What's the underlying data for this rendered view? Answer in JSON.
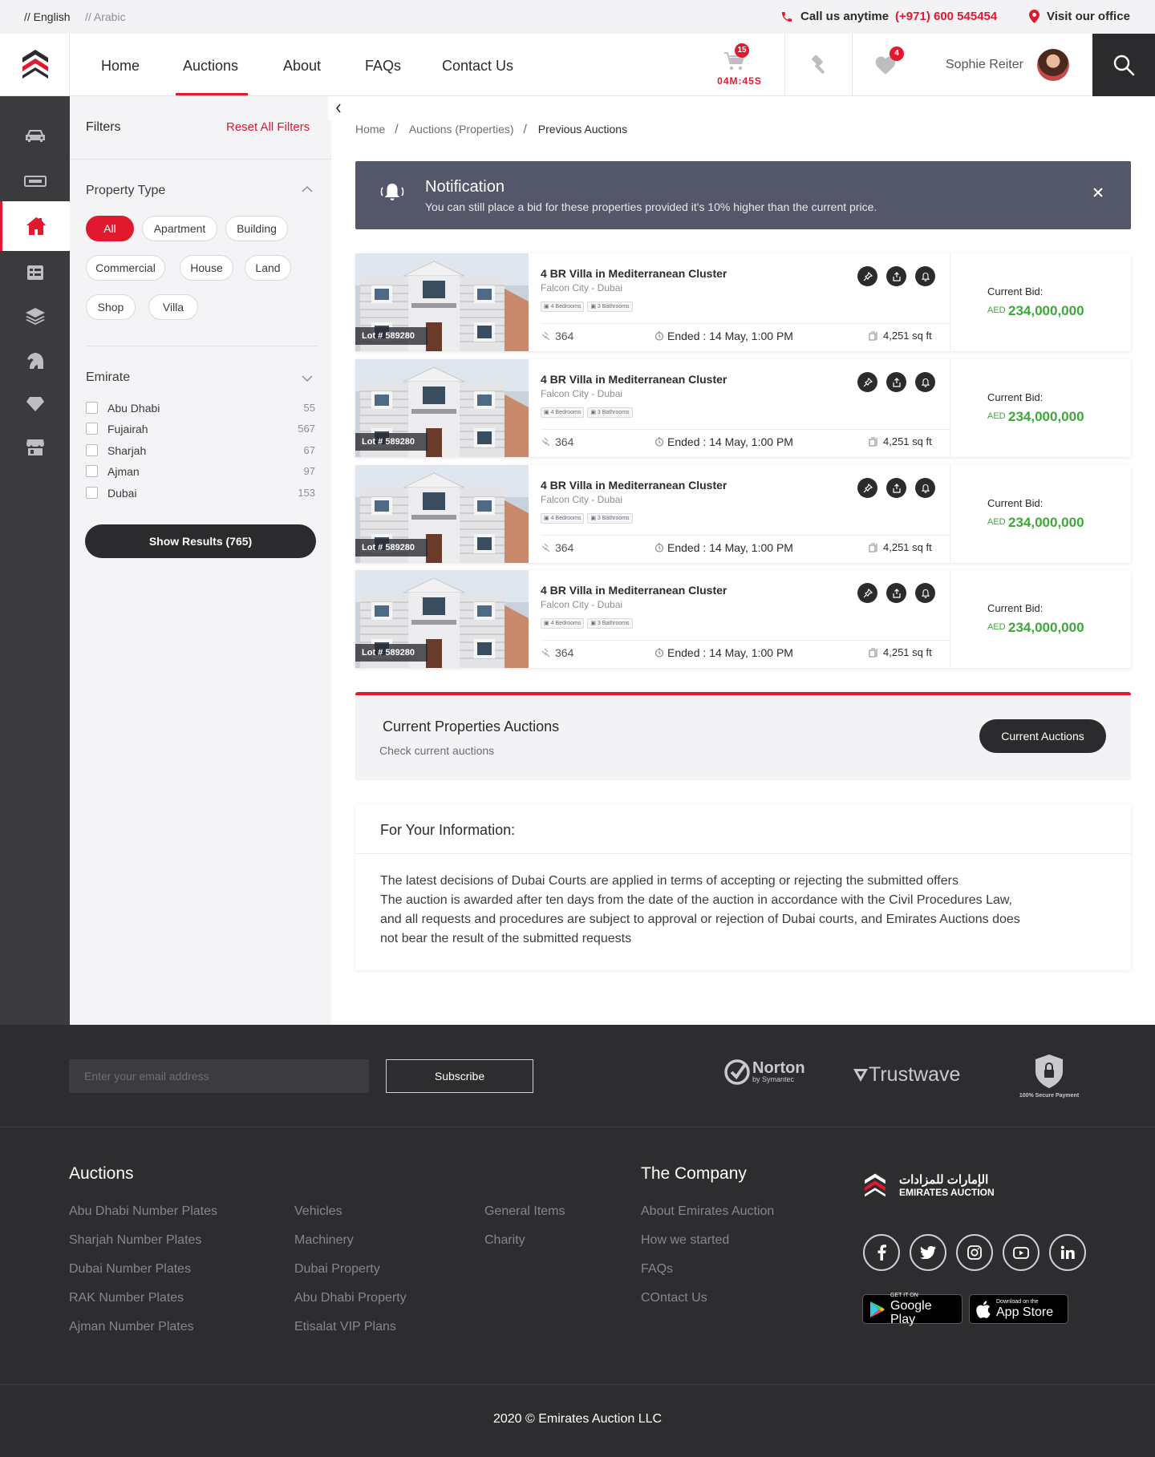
{
  "topbar": {
    "lang_en": "// English",
    "lang_ar": "// Arabic",
    "call_label": "Call us anytime",
    "phone": "(+971) 600 545454",
    "office": "Visit our office"
  },
  "nav": {
    "items": [
      "Home",
      "Auctions",
      "About",
      "FAQs",
      "Contact Us"
    ],
    "active": "Auctions"
  },
  "header": {
    "cart_count": "15",
    "timer": "04M:45S",
    "wishlist_count": "4",
    "user_name": "Sophie Reiter"
  },
  "filters": {
    "title": "Filters",
    "reset": "Reset All Filters",
    "property_type_title": "Property Type",
    "chips": [
      "All",
      "Apartment",
      "Building",
      "Commercial",
      "House",
      "Land",
      "Shop",
      "Villa"
    ],
    "selected_chip": "All",
    "emirate_title": "Emirate",
    "emirates": [
      {
        "name": "Abu Dhabi",
        "count": "55"
      },
      {
        "name": "Fujairah",
        "count": "567"
      },
      {
        "name": "Sharjah",
        "count": "67"
      },
      {
        "name": "Ajman",
        "count": "97"
      },
      {
        "name": "Dubai",
        "count": "153"
      }
    ],
    "show_results": "Show Results (765)"
  },
  "breadcrumb": {
    "items": [
      "Home",
      "Auctions (Properties)",
      "Previous Auctions"
    ],
    "separator": "/"
  },
  "notification": {
    "title": "Notification",
    "message": "You can still place a bid for these properties provided it's 10% higher than the current price."
  },
  "listings": [
    {
      "lot": "Lot # 589280",
      "title": "4 BR Villa in Mediterranean Cluster",
      "location": "Falcon City - Dubai",
      "bedrooms": "4 Bedrooms",
      "bathrooms": "3 Bathrooms",
      "bids": "364",
      "ended": "Ended : 14 May, 1:00 PM",
      "area": "4,251 sq ft",
      "bid_label": "Current Bid:",
      "currency": "AED",
      "amount": "234,000,000"
    },
    {
      "lot": "Lot # 589280",
      "title": "4 BR Villa in Mediterranean Cluster",
      "location": "Falcon City - Dubai",
      "bedrooms": "4 Bedrooms",
      "bathrooms": "3 Bathrooms",
      "bids": "364",
      "ended": "Ended : 14 May, 1:00 PM",
      "area": "4,251 sq ft",
      "bid_label": "Current Bid:",
      "currency": "AED",
      "amount": "234,000,000"
    },
    {
      "lot": "Lot # 589280",
      "title": "4 BR Villa in Mediterranean Cluster",
      "location": "Falcon City - Dubai",
      "bedrooms": "4 Bedrooms",
      "bathrooms": "3 Bathrooms",
      "bids": "364",
      "ended": "Ended : 14 May, 1:00 PM",
      "area": "4,251 sq ft",
      "bid_label": "Current Bid:",
      "currency": "AED",
      "amount": "234,000,000"
    },
    {
      "lot": "Lot # 589280",
      "title": "4 BR Villa in Mediterranean Cluster",
      "location": "Falcon City - Dubai",
      "bedrooms": "4 Bedrooms",
      "bathrooms": "3 Bathrooms",
      "bids": "364",
      "ended": "Ended : 14 May, 1:00 PM",
      "area": "4,251 sq ft",
      "bid_label": "Current Bid:",
      "currency": "AED",
      "amount": "234,000,000"
    }
  ],
  "current_auctions": {
    "title": "Current Properties Auctions",
    "subtitle": "Check current auctions",
    "button": "Current Auctions"
  },
  "fyi": {
    "title": "For Your Information:",
    "lines": [
      "The latest decisions of Dubai Courts are applied in terms of accepting or rejecting the submitted offers",
      "The auction is awarded after ten days from the date of the auction in accordance with the Civil Procedures Law,",
      "and all requests and procedures are subject to approval or rejection of Dubai courts, and Emirates Auctions does",
      "not bear the result of the submitted requests"
    ]
  },
  "footer": {
    "email_placeholder": "Enter your email address",
    "subscribe": "Subscribe",
    "norton_name": "Norton",
    "norton_sub": "by Symantec",
    "trustwave": "Trustwave",
    "secure_payment": "100% Secure Payment",
    "auctions_title": "Auctions",
    "auctions_col1": [
      "Abu Dhabi Number Plates",
      "Sharjah Number Plates",
      "Dubai Number Plates",
      "RAK Number Plates",
      "Ajman Number Plates"
    ],
    "auctions_col2": [
      "Vehicles",
      "Machinery",
      "Dubai Property",
      "Abu Dhabi Property",
      "Etisalat VIP Plans"
    ],
    "auctions_col3": [
      "General Items",
      "Charity"
    ],
    "company_title": "The Company",
    "company_links": [
      "About Emirates Auction",
      "How we started",
      "FAQs",
      "COntact Us"
    ],
    "brand_ar": "الإمارات للمزادات",
    "brand_en": "EMIRATES AUCTION",
    "social": [
      "f",
      "t",
      "ig",
      "yt",
      "in"
    ],
    "google_small": "GET IT ON",
    "google_big": "Google Play",
    "apple_small": "Download on the",
    "apple_big": "App Store",
    "copyright": "2020 © Emirates Auction LLC"
  },
  "colors": {
    "accent": "#e0192f",
    "dark": "#2b2b2d",
    "rail": "#3b3b3d",
    "price_green": "#3ba838",
    "notification_bg": "#545669"
  }
}
